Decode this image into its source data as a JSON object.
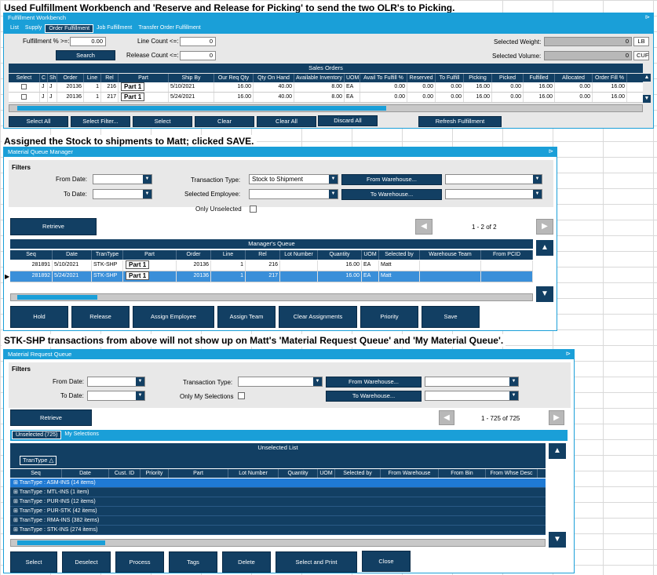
{
  "captions": {
    "c1": "Used Fulfillment Workbench and 'Reserve and Release for Picking' to send the two OLR's to Picking.",
    "c2": "Assigned the Stock to shipments to Matt; clicked SAVE.",
    "c3": "STK-SHP transactions from above will not show up on Matt's 'Material Request Queue' and 'My Material Queue'."
  },
  "fw": {
    "title": "Fulfillment Workbench",
    "tabs": [
      "List",
      "Supply",
      "Order Fulfillment",
      "Job Fulfillment",
      "Transfer Order Fulfillment"
    ],
    "fulfillment_label": "Fulfillment % >=:",
    "fulfillment_value": "0.00",
    "line_count_label": "Line Count <=:",
    "line_count_value": "0",
    "release_count_label": "Release Count <=:",
    "release_count_value": "0",
    "search_label": "Search",
    "sel_weight_label": "Selected Weight:",
    "sel_weight_value": "0",
    "sel_weight_unit": "LB",
    "sel_volume_label": "Selected Volume:",
    "sel_volume_value": "0",
    "sel_volume_unit": "CUF",
    "grid_title": "Sales Orders",
    "columns": [
      "Select",
      "C",
      "Sh",
      "Order",
      "Line",
      "Rel",
      "Part",
      "Ship By",
      "Our Req Qty",
      "Qty On Hand",
      "Available Inventory",
      "UOM",
      "Avail To Fulfill %",
      "Reserved",
      "To Fulfill",
      "Picking",
      "Picked",
      "Fulfilled",
      "Allocated",
      "Order Fill %"
    ],
    "rows": [
      [
        "",
        "J",
        "J",
        "20136",
        "1",
        "216",
        "Part 1",
        "5/10/2021",
        "16.00",
        "40.00",
        "8.00",
        "EA",
        "0.00",
        "0.00",
        "0.00",
        "16.00",
        "0.00",
        "16.00",
        "0.00",
        "16.00"
      ],
      [
        "",
        "J",
        "J",
        "20136",
        "1",
        "217",
        "Part 1",
        "5/24/2021",
        "16.00",
        "40.00",
        "8.00",
        "EA",
        "0.00",
        "0.00",
        "0.00",
        "16.00",
        "0.00",
        "16.00",
        "0.00",
        "16.00"
      ]
    ],
    "buttons": [
      "Select All",
      "Select Filter...",
      "Select",
      "Clear",
      "Clear All",
      "Discard All",
      "Refresh Fulfillment"
    ]
  },
  "mqm": {
    "title": "Material Queue Manager",
    "filters": "Filters",
    "from_date": "From Date:",
    "to_date": "To Date:",
    "tran_type_label": "Transaction Type:",
    "tran_type_value": "Stock to Shipment",
    "sel_emp_label": "Selected Employee:",
    "only_unselected": "Only Unselected",
    "from_wh": "From Warehouse...",
    "to_wh": "To Warehouse...",
    "retrieve": "Retrieve",
    "paging": "1 - 2 of 2",
    "grid_title": "Manager's Queue",
    "columns": [
      "Seq",
      "Date",
      "TranType",
      "Part",
      "Order",
      "Line",
      "Rel",
      "Lot Number",
      "Quantity",
      "UOM",
      "Selected by",
      "Warehouse Team",
      "From PCID"
    ],
    "rows": [
      [
        "281891",
        "5/10/2021",
        "STK-SHP",
        "Part 1",
        "20136",
        "1",
        "216",
        "",
        "16.00",
        "EA",
        "Matt",
        "",
        ""
      ],
      [
        "281892",
        "5/24/2021",
        "STK-SHP",
        "Part 1",
        "20136",
        "1",
        "217",
        "",
        "16.00",
        "EA",
        "Matt",
        "",
        ""
      ]
    ],
    "buttons": [
      "Hold",
      "Release",
      "Assign Employee",
      "Assign Team",
      "Clear Assignments",
      "Priority",
      "Save"
    ]
  },
  "mrq": {
    "title": "Material Request Queue",
    "filters": "Filters",
    "from_date": "From Date:",
    "to_date": "To Date:",
    "tran_type_label": "Transaction Type:",
    "only_my": "Only My Selections",
    "from_wh": "From Warehouse...",
    "to_wh": "To Warehouse...",
    "retrieve": "Retrieve",
    "paging": "1 - 725 of 725",
    "tab_unselected": "Unselected (725)",
    "tab_my": "My Selections",
    "list_title": "Unselected List",
    "group_chip": "TranType",
    "columns": [
      "Seq",
      "Date",
      "Cust. ID",
      "Priority",
      "Part",
      "Lot Number",
      "Quantity",
      "UOM",
      "Selected by",
      "From Warehouse",
      "From Bin",
      "From Whse Desc"
    ],
    "groups": [
      "TranType : ASM-INS (14 items)",
      "TranType : MTL-INS (1 item)",
      "TranType : PUR-INS (12 items)",
      "TranType : PUR-STK (42 items)",
      "TranType : RMA-INS (382 items)",
      "TranType : STK-INS (274 items)"
    ],
    "buttons": [
      "Select",
      "Deselect",
      "Process",
      "Tags",
      "Delete",
      "Select and Print",
      "Close"
    ]
  }
}
